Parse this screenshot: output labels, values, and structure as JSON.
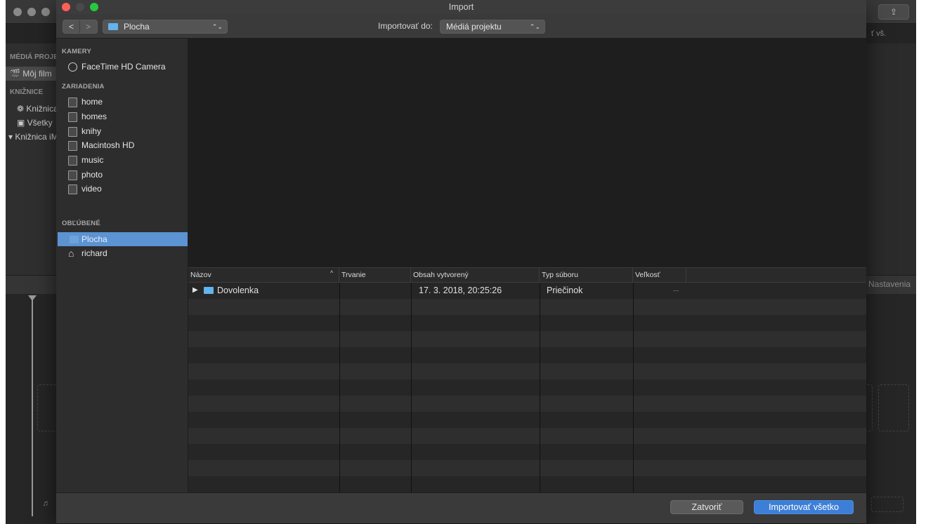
{
  "app": {
    "sidebar": {
      "media_heading": "MÉDIÁ PROJEKTU",
      "project_item": "Môj film",
      "libraries_heading": "KNIŽNICE",
      "library_items": [
        "Knižnica",
        "Všetky",
        "Knižnica iMovie"
      ]
    },
    "right_clip_text": "ť vš.",
    "settings_label": "Nastavenia",
    "share_icon": "share-icon"
  },
  "dialog": {
    "title": "Import",
    "toolbar": {
      "back_glyph": "<",
      "forward_glyph": ">",
      "location": "Plocha",
      "import_to_label": "Importovať do:",
      "import_to_value": "Médiá projektu",
      "popup_arrow": "⌃⌄"
    },
    "sidebar": {
      "cameras_heading": "KAMERY",
      "cameras": [
        "FaceTime HD Camera"
      ],
      "devices_heading": "ZARIADENIA",
      "devices": [
        "home",
        "homes",
        "knihy",
        "Macintosh HD",
        "music",
        "photo",
        "video"
      ],
      "favorites_heading": "OBĽÚBENÉ",
      "favorites": [
        "Plocha",
        "richard"
      ],
      "selected_favorite": "Plocha"
    },
    "table": {
      "columns": [
        "Názov",
        "Trvanie",
        "Obsah vytvorený",
        "Typ súboru",
        "Veľkosť"
      ],
      "rows": [
        {
          "name": "Dovolenka",
          "duration": "",
          "created": "17. 3. 2018, 20:25:26",
          "type": "Priečinok",
          "size": "--"
        }
      ]
    },
    "footer": {
      "close_label": "Zatvoriť",
      "import_all_label": "Importovať všetko"
    }
  }
}
